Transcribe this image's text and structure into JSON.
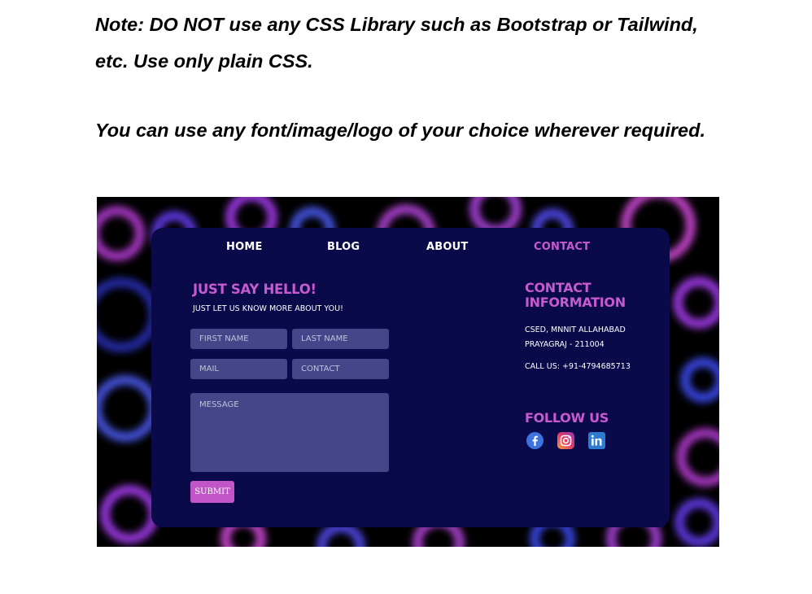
{
  "notes": {
    "line1": "Note: DO NOT use any CSS Library such as Bootstrap or Tailwind, etc. Use only plain CSS.",
    "line2": "You can use any font/image/logo of your choice wherever required."
  },
  "nav": {
    "home": "HOME",
    "blog": "BLOG",
    "about": "ABOUT",
    "contact": "CONTACT"
  },
  "form": {
    "title": "JUST SAY HELLO!",
    "subtitle": "JUST LET US KNOW MORE ABOUT YOU!",
    "first_name_placeholder": "FIRST NAME",
    "last_name_placeholder": "LAST NAME",
    "mail_placeholder": "MAIL",
    "contact_placeholder": "CONTACT",
    "message_placeholder": "MESSAGE",
    "submit_label": "SUBMIT"
  },
  "contact_info": {
    "title": "CONTACT INFORMATION",
    "address_line1": "CSED, MNNIT ALLAHABAD",
    "address_line2": "PRAYAGRAJ - 211004",
    "phone": "CALL US: +91-4794685713"
  },
  "follow": {
    "title": "FOLLOW US",
    "icons": [
      "facebook-icon",
      "instagram-icon",
      "linkedin-icon"
    ]
  },
  "colors": {
    "card_bg": "#0a0a4a",
    "accent": "#c85ad0",
    "field_bg": "#45458a",
    "submit_bg": "#c256c8"
  }
}
